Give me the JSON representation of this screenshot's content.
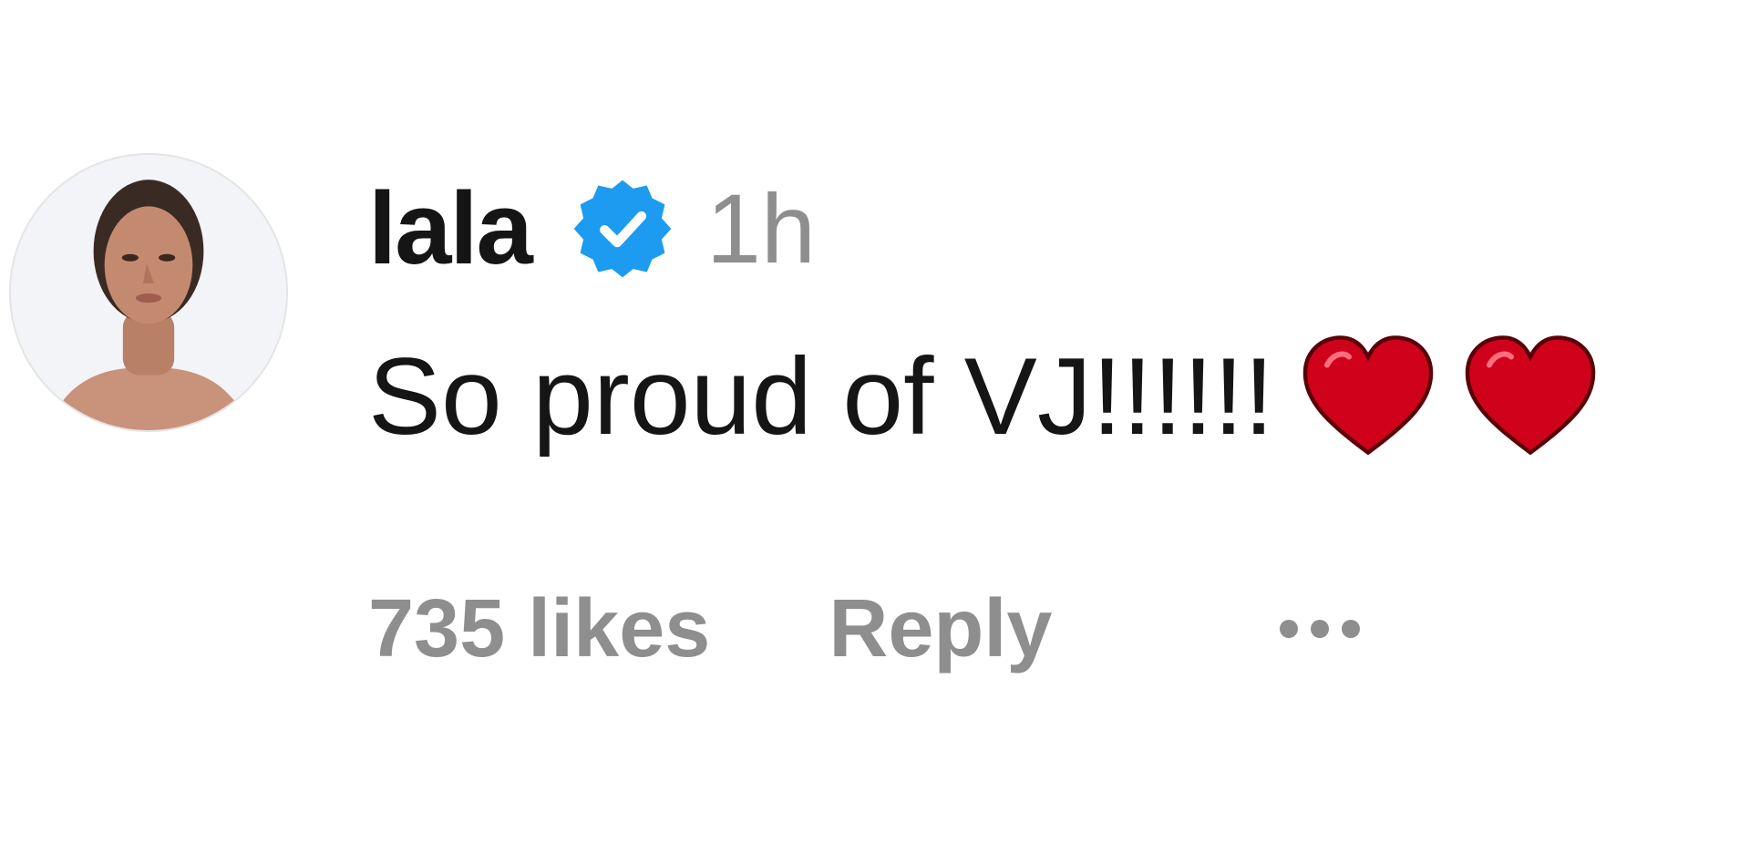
{
  "comment": {
    "username": "lala",
    "timestamp": "1h",
    "text": "So proud of VJ!!!!!!",
    "emoji": [
      "heart-icon",
      "heart-icon"
    ],
    "likes_label": "735 likes",
    "reply_label": "Reply",
    "verified": true
  },
  "colors": {
    "primary_text": "#151515",
    "secondary_text": "#8e8e8e",
    "verified_blue": "#1d9bf0",
    "heart_red": "#d0021b"
  },
  "icons": {
    "verified": "verified-badge-icon",
    "more": "more-options-icon",
    "avatar": "avatar"
  }
}
